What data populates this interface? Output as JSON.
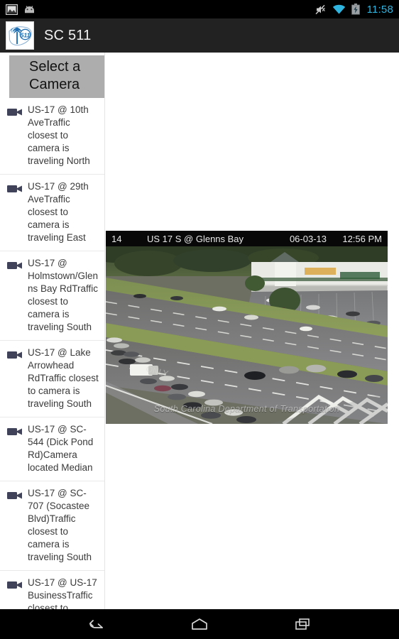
{
  "status_bar": {
    "icons": [
      "screenshot-icon",
      "android-robot-icon",
      "volume-muted-icon",
      "wifi-icon",
      "battery-charging-icon"
    ],
    "clock": "11:58",
    "clock_color": "#2fb4e0"
  },
  "action_bar": {
    "app_icon": "sc511-logo-icon",
    "title": "SC 511",
    "background": "#222222"
  },
  "sidebar": {
    "header": "Select a Camera",
    "header_background": "#adadad",
    "items": [
      {
        "icon": "video-camera-icon",
        "name": "US-17 @ 10th Ave",
        "desc": "Traffic closest to camera is traveling North"
      },
      {
        "icon": "video-camera-icon",
        "name": "US-17 @ 29th Ave",
        "desc": "Traffic closest to camera is traveling East"
      },
      {
        "icon": "video-camera-icon",
        "name": "US-17 @ Holmstown/Glenns Bay Rd",
        "desc": "Traffic closest to camera is traveling South"
      },
      {
        "icon": "video-camera-icon",
        "name": "US-17 @ Lake Arrowhead Rd",
        "desc": "Traffic closest to camera is traveling South"
      },
      {
        "icon": "video-camera-icon",
        "name": "US-17 @ SC-544 (Dick Pond Rd)",
        "desc": "Camera located Median"
      },
      {
        "icon": "video-camera-icon",
        "name": "US-17 @ SC-707 (Socastee Blvd)",
        "desc": "Traffic closest to camera is traveling South"
      },
      {
        "icon": "video-camera-icon",
        "name": "US-17 @ US-17 Business",
        "desc": "Traffic closest to camera is"
      }
    ]
  },
  "camera_view": {
    "overlay_id": "14",
    "overlay_name": "US 17  S @ Glenns Bay",
    "overlay_date": "06-03-13",
    "overlay_time": "12:56 PM",
    "watermark": "South Carolina Department of Transportation"
  },
  "nav_bar": {
    "buttons": [
      "back-button",
      "home-button",
      "recents-button"
    ]
  }
}
